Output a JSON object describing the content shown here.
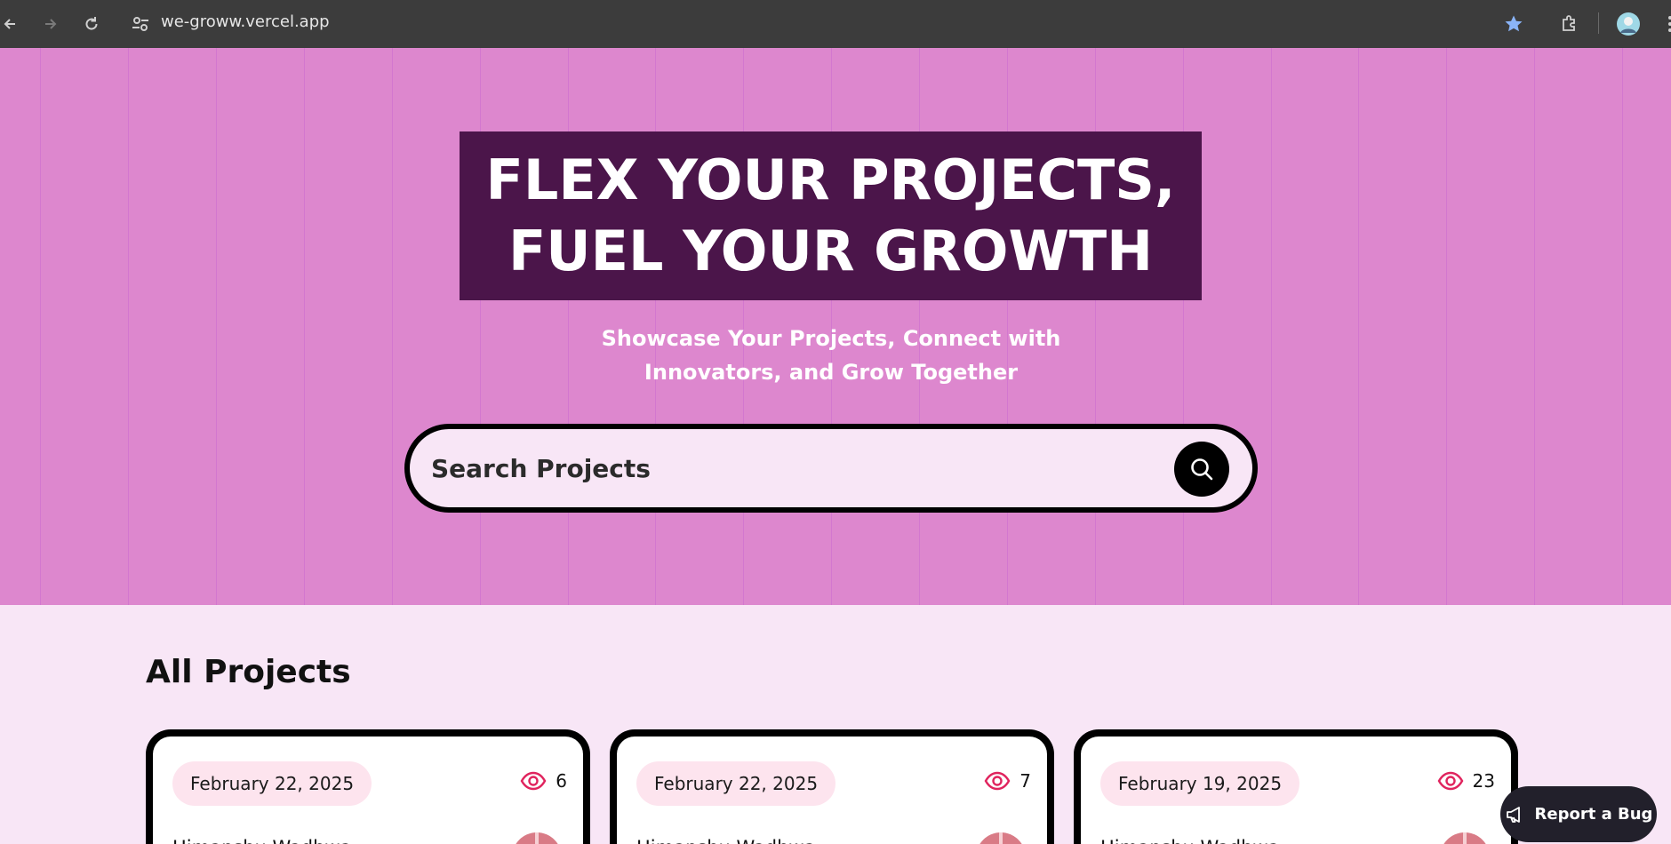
{
  "browser": {
    "url": "we-groww.vercel.app"
  },
  "hero": {
    "headline_line1": "FLEX YOUR PROJECTS,",
    "headline_line2": "FUEL YOUR GROWTH",
    "subtitle_line1": "Showcase Your Projects, Connect with",
    "subtitle_line2": "Innovators, and Grow Together",
    "search_placeholder": "Search Projects"
  },
  "projects": {
    "title": "All Projects",
    "cards": [
      {
        "date": "February 22, 2025",
        "views": "6",
        "author": "Himanshu Wadhwa"
      },
      {
        "date": "February 22, 2025",
        "views": "7",
        "author": "Himanshu Wadhwa"
      },
      {
        "date": "February 19, 2025",
        "views": "23",
        "author": "Himanshu Wadhwa"
      }
    ]
  },
  "report_bug": {
    "label": "Report a Bug"
  },
  "colors": {
    "hero_bg": "#dd87ce",
    "headline_bg": "#4b154a",
    "page_bg": "#f8e6f6",
    "views_icon": "#e0245e",
    "bookmark_star": "#8ab4f8"
  },
  "icons": {
    "back": "arrow-left-icon",
    "forward": "arrow-right-icon",
    "reload": "reload-icon",
    "site_settings": "tune-icon",
    "bookmark": "star-icon",
    "extensions": "puzzle-icon",
    "profile": "profile-avatar",
    "menu": "more-vert-icon",
    "search": "search-icon",
    "views": "eye-icon",
    "report": "megaphone-icon"
  }
}
